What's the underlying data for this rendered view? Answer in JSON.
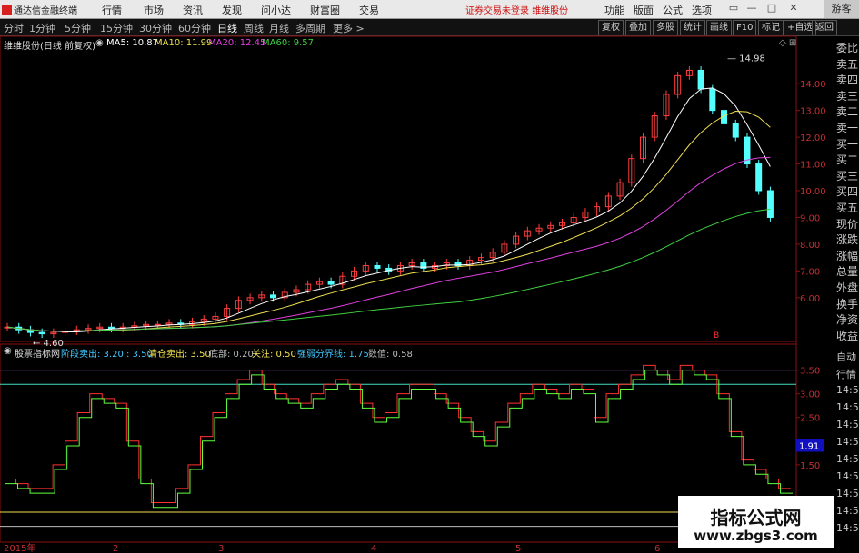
{
  "window": {
    "app_title": "通达信金融终端",
    "menus": [
      "行情",
      "市场",
      "资讯",
      "发现",
      "问小达",
      "财富圈",
      "交易"
    ],
    "warning": "证券交易未登录",
    "warning2": "维维股份",
    "right_menus": [
      "功能",
      "版面",
      "公式",
      "选项"
    ],
    "guest": "游客"
  },
  "periods": [
    "分时",
    "1分钟",
    "5分钟",
    "15分钟",
    "30分钟",
    "60分钟",
    "日线",
    "周线",
    "月线",
    "多周期",
    "更多 >"
  ],
  "active_period": "日线",
  "tools": [
    "复权",
    "叠加",
    "多股",
    "统计",
    "画线",
    "F10",
    "标记",
    "+自选",
    "返回"
  ],
  "main": {
    "stock_title": "维维股份(日线 前复权)",
    "ma": [
      {
        "label": "MA5: 10.87",
        "color": "#ffffff"
      },
      {
        "label": "MA10: 11.99",
        "color": "#f0e050"
      },
      {
        "label": "MA20: 12.45",
        "color": "#e040e0"
      },
      {
        "label": "MA60: 9.57",
        "color": "#40d040"
      }
    ],
    "high_label": "14.98",
    "low_label": "4.60",
    "marker": "B"
  },
  "indicator": {
    "name": "股票指标网",
    "params": [
      {
        "label": "阶段卖出: 3.20 : 3.50",
        "color": "#40c8ff"
      },
      {
        "label": "清仓卖出: 3.50",
        "color": "#f0e050"
      },
      {
        "label": "底部: 0.20",
        "color": "#bbbbbb"
      },
      {
        "label": "关注: 0.50",
        "color": "#f0e050"
      },
      {
        "label": "强弱分界线: 1.75",
        "color": "#40c8ff"
      },
      {
        "label": "数值: 0.58",
        "color": "#bbbbbb"
      }
    ],
    "current_value": "1.91"
  },
  "y_axis_main": [
    "14.00",
    "13.00",
    "12.00",
    "11.00",
    "10.00",
    "9.00",
    "8.00",
    "7.00",
    "6.00"
  ],
  "y_axis_ind": [
    "3.50",
    "3.00",
    "2.50",
    "2.00",
    "1.50"
  ],
  "x_axis": [
    "2015年",
    "2",
    "3",
    "4",
    "5",
    "6"
  ],
  "sidebar_top": [
    "委比",
    "卖五",
    "卖四",
    "卖三",
    "卖二",
    "卖一",
    "买一",
    "买二",
    "买三",
    "买四",
    "买五",
    "现价",
    "涨跌",
    "涨幅",
    "总量",
    "外盘",
    "换手",
    "净资",
    "收益"
  ],
  "sidebar_bottom": [
    "自动",
    "行情",
    "14:5",
    "14:5",
    "14:5",
    "14:5",
    "14:5",
    "14:5",
    "14:5",
    "14:5",
    "14:5"
  ],
  "watermark": {
    "line1": "指标公式网",
    "line2": "www.zbgs3.com"
  },
  "chart_data": {
    "type": "candlestick",
    "title": "维维股份(日线 前复权)",
    "y_range": [
      4.5,
      15.5
    ],
    "high": 14.98,
    "low": 4.6,
    "close_series_approx": [
      4.9,
      4.8,
      4.7,
      4.65,
      4.7,
      4.75,
      4.8,
      4.85,
      4.9,
      4.85,
      4.9,
      4.95,
      5.0,
      5.0,
      5.05,
      5.0,
      5.1,
      5.2,
      5.3,
      5.6,
      5.9,
      6.0,
      6.1,
      6.0,
      6.2,
      6.3,
      6.5,
      6.6,
      6.5,
      6.8,
      7.0,
      7.2,
      7.1,
      7.0,
      7.2,
      7.3,
      7.1,
      7.2,
      7.3,
      7.2,
      7.4,
      7.5,
      7.7,
      8.0,
      8.3,
      8.5,
      8.6,
      8.7,
      8.8,
      9.0,
      9.2,
      9.4,
      9.8,
      10.3,
      11.2,
      12.0,
      12.8,
      13.6,
      14.3,
      14.5,
      13.8,
      13.0,
      12.5,
      12.0,
      11.0,
      10.0,
      9.0
    ],
    "indicator": {
      "name": "股票指标网",
      "lines": {
        "阶段卖出": [
          3.2,
          3.5
        ],
        "清仓卖出": 3.5,
        "底部": 0.2,
        "关注": 0.5,
        "强弱分界线": 1.75
      },
      "current": 0.58,
      "y_range": [
        0,
        3.8
      ]
    }
  }
}
